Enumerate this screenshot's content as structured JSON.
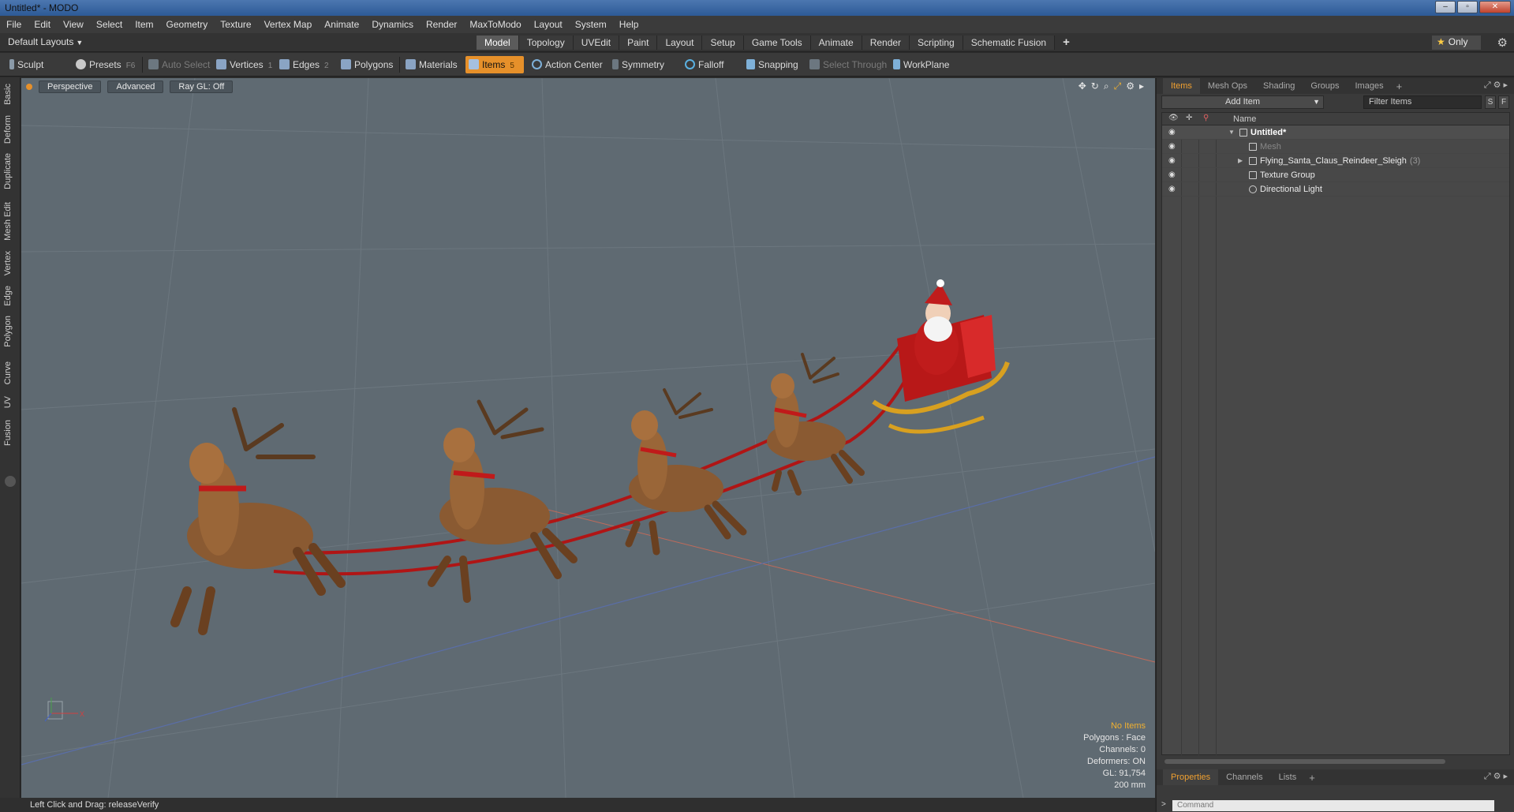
{
  "window": {
    "title": "Untitled* - MODO",
    "controls": [
      "–",
      "▫",
      "✕"
    ]
  },
  "menu": [
    "File",
    "Edit",
    "View",
    "Select",
    "Item",
    "Geometry",
    "Texture",
    "Vertex Map",
    "Animate",
    "Dynamics",
    "Render",
    "MaxToModo",
    "Layout",
    "System",
    "Help"
  ],
  "layout": {
    "selector": "Default Layouts",
    "tabs": [
      "Model",
      "Topology",
      "UVEdit",
      "Paint",
      "Layout",
      "Setup",
      "Game Tools",
      "Animate",
      "Render",
      "Scripting",
      "Schematic Fusion"
    ],
    "active_tab": "Model",
    "only_label": "Only"
  },
  "toolbar": {
    "sculpt": "Sculpt",
    "presets": "Presets",
    "presets_key": "F6",
    "auto_select": "Auto Select",
    "vertices": "Vertices",
    "vertices_key": "1",
    "edges": "Edges",
    "edges_key": "2",
    "polygons": "Polygons",
    "materials": "Materials",
    "items": "Items",
    "items_key": "5",
    "action_center": "Action Center",
    "symmetry": "Symmetry",
    "falloff": "Falloff",
    "snapping": "Snapping",
    "select_through": "Select Through",
    "workplane": "WorkPlane"
  },
  "left_tabs": [
    "Basic",
    "Deform",
    "Duplicate",
    "Mesh Edit",
    "Vertex",
    "Edge",
    "Polygon",
    "Curve",
    "UV",
    "Fusion"
  ],
  "viewport": {
    "view": "Perspective",
    "mode": "Advanced",
    "raygl": "Ray GL: Off",
    "info": {
      "no_items": "No Items",
      "polygons": "Polygons : Face",
      "channels": "Channels: 0",
      "deformers": "Deformers: ON",
      "gl": "GL: 91,754",
      "scale": "200 mm"
    }
  },
  "status": "Left Click and Drag:  releaseVerify",
  "panel": {
    "top_tabs": [
      "Items",
      "Mesh Ops",
      "Shading",
      "Groups",
      "Images"
    ],
    "active_top_tab": "Items",
    "add_item": "Add Item",
    "filter_placeholder": "Filter Items",
    "filter_s": "S",
    "filter_f": "F",
    "name_header": "Name",
    "tree": [
      {
        "label": "Untitled*",
        "style": "bold",
        "level": 0
      },
      {
        "label": "Mesh",
        "style": "dim",
        "level": 1
      },
      {
        "label": "Flying_Santa_Claus_Reindeer_Sleigh",
        "count": "(3)",
        "style": "normal",
        "level": 1
      },
      {
        "label": "Texture Group",
        "style": "normal",
        "level": 1
      },
      {
        "label": "Directional Light",
        "style": "normal",
        "level": 1
      }
    ],
    "bottom_tabs": [
      "Properties",
      "Channels",
      "Lists"
    ],
    "active_bottom_tab": "Properties",
    "command_placeholder": "Command"
  },
  "colors": {
    "accent": "#e6902a",
    "viewport_bg": "#5f6a72",
    "highlight_text": "#f0b030"
  }
}
